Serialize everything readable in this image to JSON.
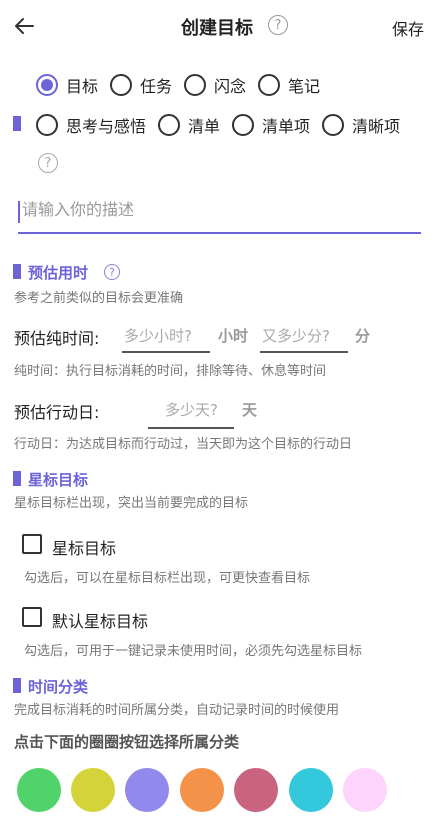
{
  "header": {
    "title": "创建目标",
    "help_glyph": "?",
    "save_label": "保存"
  },
  "type_options": [
    {
      "label": "目标",
      "checked": true
    },
    {
      "label": "任务",
      "checked": false
    },
    {
      "label": "闪念",
      "checked": false
    },
    {
      "label": "笔记",
      "checked": false
    }
  ],
  "subtype_options": [
    {
      "label": "思考与感悟",
      "checked": false
    },
    {
      "label": "清单",
      "checked": false
    },
    {
      "label": "清单项",
      "checked": false
    },
    {
      "label": "清晰项",
      "checked": false
    }
  ],
  "description": {
    "placeholder": "请输入你的描述",
    "value": ""
  },
  "estimate": {
    "title": "预估用时",
    "hint": "参考之前类似的目标会更准确",
    "pure_time_label": "预估纯时间:",
    "hours_placeholder": "多少小时?",
    "hours_unit": "小时",
    "minutes_placeholder": "又多少分?",
    "minutes_unit": "分",
    "pure_time_hint": "纯时间：执行目标消耗的时间，排除等待、休息等时间",
    "action_days_label": "预估行动日:",
    "days_placeholder": "多少天?",
    "days_unit": "天",
    "action_days_hint": "行动日：为达成目标而行动过，当天即为这个目标的行动日"
  },
  "star": {
    "title": "星标目标",
    "hint": "星标目标栏出现，突出当前要完成的目标",
    "star_checkbox_label": "星标目标",
    "star_checkbox_hint": "勾选后，可以在星标目标栏出现，可更快查看目标",
    "default_checkbox_label": "默认星标目标",
    "default_checkbox_hint": "勾选后，可用于一键记录未使用时间，必须先勾选星标目标"
  },
  "category": {
    "title": "时间分类",
    "hint": "完成目标消耗的时间所属分类，自动记录时间的时候使用",
    "instruction": "点击下面的圈圈按钮选择所属分类",
    "colors": [
      "#4fd36a",
      "#d4d43a",
      "#9289ec",
      "#f5924a",
      "#c86480",
      "#34c8dc",
      "#fdd4fc"
    ]
  },
  "colors": {
    "accent": "#6c63d9"
  }
}
